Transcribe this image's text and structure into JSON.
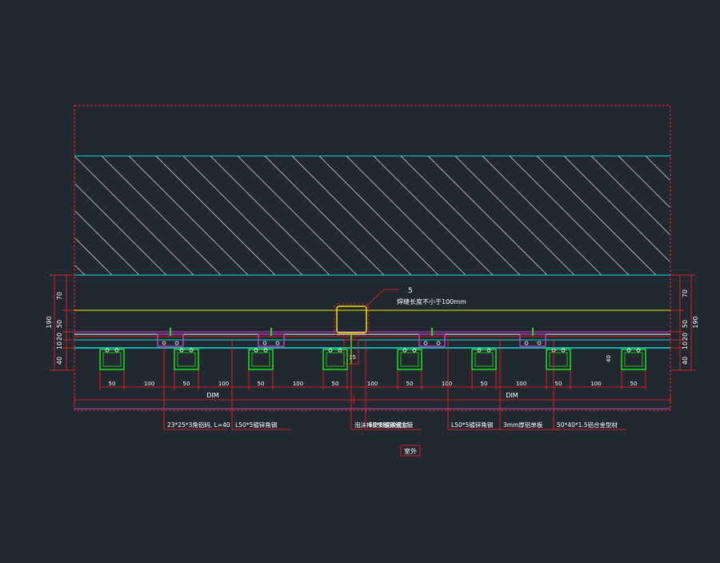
{
  "colors": {
    "background": "#212830",
    "frame": "#ff2020",
    "cyan": "#00e5e5",
    "yellow": "#e8e800",
    "green": "#20e020",
    "magenta": "#e040e0",
    "white": "#ffffff",
    "hatch": "#c8c8c8"
  },
  "dims": {
    "left": [
      "70",
      "50",
      "20",
      "10",
      "40",
      "190"
    ],
    "right": [
      "70",
      "50",
      "20",
      "10",
      "40",
      "190"
    ],
    "bottom_spacing": [
      "50",
      "100",
      "50",
      "100",
      "50",
      "100",
      "50",
      "100",
      "50",
      "100",
      "50",
      "100",
      "50",
      "100",
      "50"
    ],
    "total_left": "DIM",
    "total_right": "DIM",
    "small_40": "40",
    "small_15": "15"
  },
  "annotations": {
    "weld_number": "5",
    "weld_note": "焊缝长度不小于100mm"
  },
  "callouts": [
    "23*25*3角铝码, L=40",
    "L50*5镀锌角钢",
    "泡沫棒及耐候胶密封",
    "60*6镀锌钢方管",
    "L50*5镀锌角钢",
    "3mm厚铝单板",
    "50*40*1.5铝合金型材"
  ],
  "exterior_label": "室外"
}
